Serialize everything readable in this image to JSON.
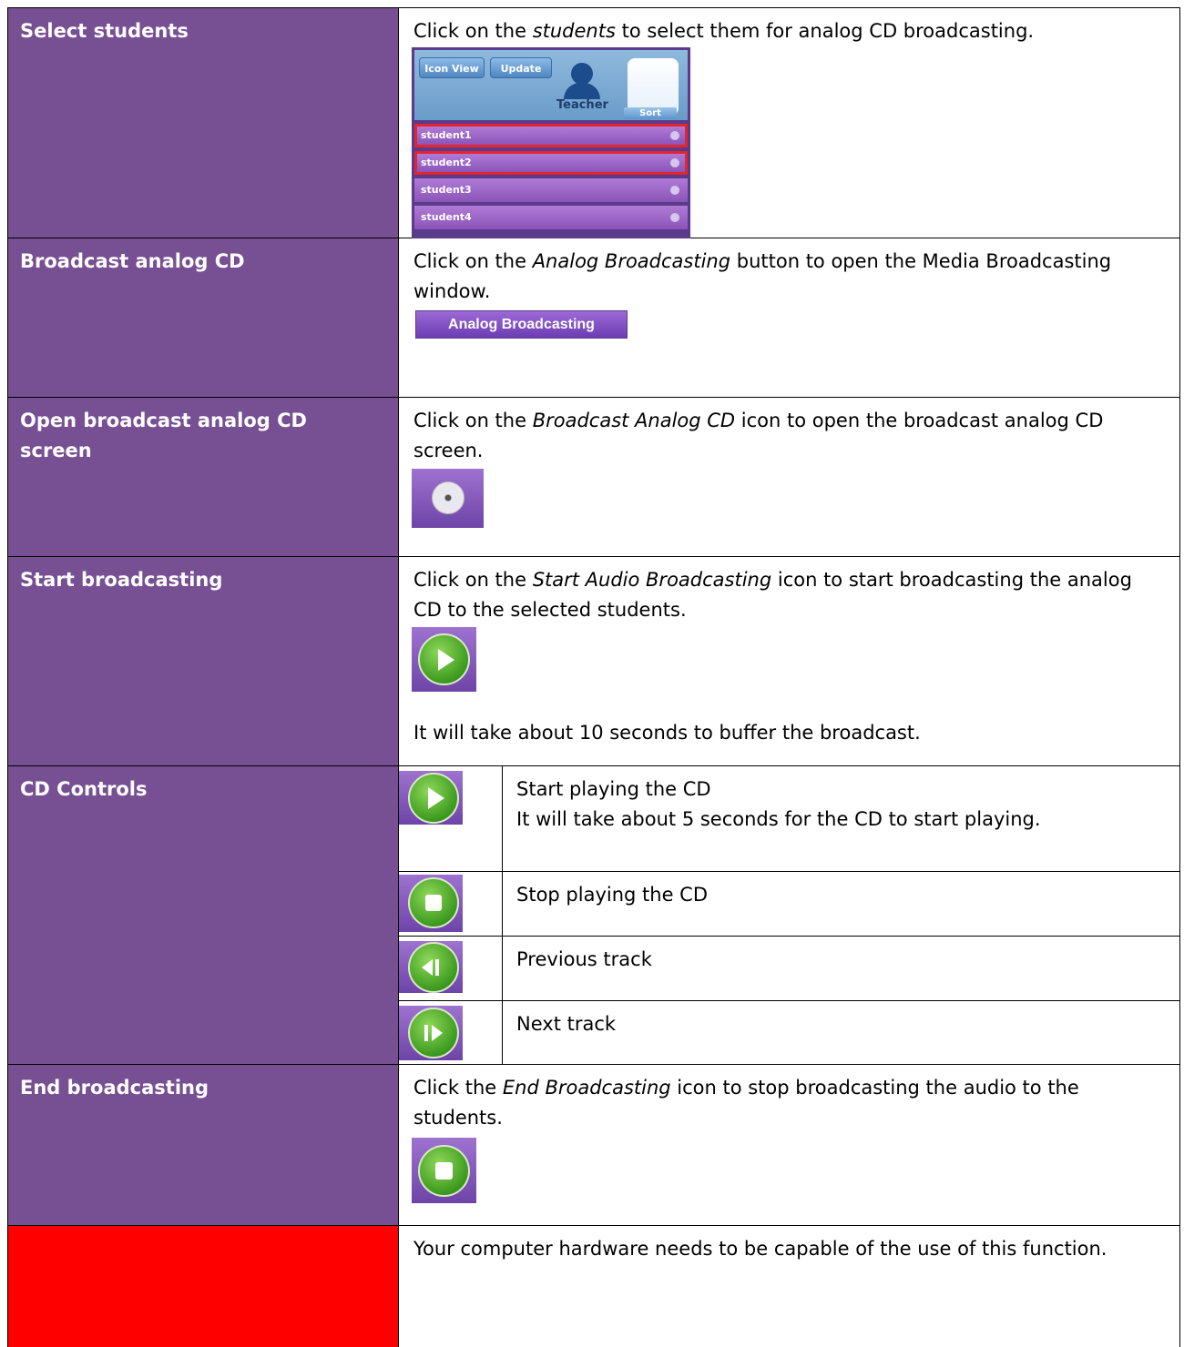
{
  "rows": [
    {
      "label": "Select students",
      "parts": [
        "Click on the ",
        "students",
        " to select them for analog CD broadcasting."
      ]
    },
    {
      "label": "Broadcast analog CD",
      "parts": [
        "Click on the ",
        "Analog Broadcasting",
        " button to open the Media Broadcasting window."
      ]
    },
    {
      "label": "Open broadcast analog CD screen",
      "parts": [
        "Click on the ",
        "Broadcast Analog CD",
        " icon to open the broadcast analog CD screen."
      ]
    },
    {
      "label": "Start broadcasting",
      "parts": [
        "Click on the ",
        "Start Audio Broadcasting",
        " icon to start broadcasting the analog CD to the selected students."
      ],
      "note": "It will take about 10 seconds to buffer the broadcast."
    },
    {
      "label": "CD Controls",
      "controls": [
        {
          "icon": "play-icon",
          "line1": "Start playing the CD",
          "line2": "It will take about 5 seconds for the CD to start playing."
        },
        {
          "icon": "stop-icon",
          "line1": "Stop playing the CD"
        },
        {
          "icon": "previous-track-icon",
          "line1": "Previous track"
        },
        {
          "icon": "next-track-icon",
          "line1": "Next track"
        }
      ]
    },
    {
      "label": "End broadcasting",
      "parts": [
        "Click the ",
        "End Broadcasting",
        " icon to stop broadcasting the audio to the students."
      ]
    },
    {
      "label": "",
      "text": "Your computer hardware needs to be capable of the use of this function."
    }
  ],
  "student_panel": {
    "icon_view_label": "Icon View",
    "update_label": "Update",
    "teacher_label": "Teacher",
    "sort_label": "Sort",
    "students": [
      "student1",
      "student2",
      "student3",
      "student4"
    ],
    "selected": [
      "student1",
      "student2"
    ]
  },
  "analog_button_label": "Analog Broadcasting",
  "colors": {
    "label_cell": "#774f93",
    "warning_cell": "#ff0000",
    "selection_border": "#e4242e"
  }
}
